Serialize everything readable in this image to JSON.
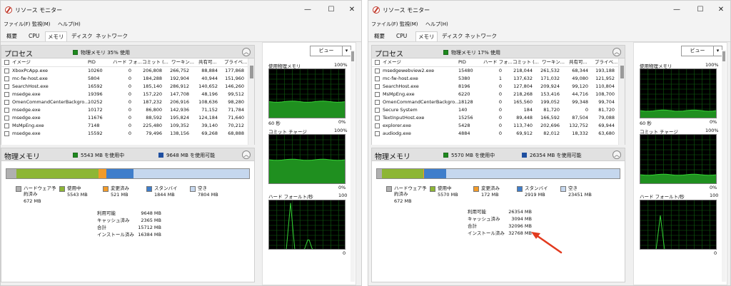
{
  "windows": [
    {
      "title": "リソース モニター",
      "menu": [
        "ファイル(F)",
        "監視(M)",
        "ヘルプ(H)"
      ],
      "tabs": [
        "概要",
        "CPU",
        "メモリ",
        "ディスク",
        "ネットワーク"
      ],
      "active_tab": "メモリ",
      "process": {
        "section_title": "プロセス",
        "header_status": "物理メモリ 35% 使用",
        "columns": [
          "イメージ",
          "PID",
          "ハード フォ...",
          "コミット (...",
          "ワーキン...",
          "共有可...",
          "プライベ..."
        ],
        "rows": [
          [
            "XboxPcApp.exe",
            "10260",
            "0",
            "206,808",
            "266,752",
            "88,884",
            "177,868"
          ],
          [
            "mc-fw-host.exe",
            "5804",
            "0",
            "184,288",
            "192,904",
            "40,944",
            "151,960"
          ],
          [
            "SearchHost.exe",
            "16592",
            "0",
            "185,140",
            "286,912",
            "140,652",
            "146,260"
          ],
          [
            "msedge.exe",
            "19396",
            "0",
            "157,220",
            "147,708",
            "48,196",
            "99,512"
          ],
          [
            "OmenCommandCenterBackgro...",
            "10252",
            "0",
            "187,232",
            "206,916",
            "108,636",
            "98,280"
          ],
          [
            "msedge.exe",
            "10172",
            "0",
            "86,800",
            "142,936",
            "71,152",
            "71,784"
          ],
          [
            "msedge.exe",
            "11676",
            "0",
            "88,592",
            "195,824",
            "124,184",
            "71,640"
          ],
          [
            "MsMpEng.exe",
            "7148",
            "0",
            "225,480",
            "109,352",
            "39,140",
            "70,212"
          ],
          [
            "msedge.exe",
            "15592",
            "0",
            "79,496",
            "138,156",
            "69,268",
            "68,888"
          ]
        ]
      },
      "physical": {
        "section_title": "物理メモリ",
        "in_use_text": "5543 MB を使用中",
        "available_text": "9648 MB を使用可能",
        "bar_fractions": {
          "hw_reserved": 0.041,
          "in_use": 0.338,
          "modified": 0.032,
          "standby": 0.112,
          "free": 0.477
        },
        "legend": [
          {
            "label": "ハードウェア予約済み",
            "value": "672 MB",
            "color": "#b0b0b0"
          },
          {
            "label": "使用中",
            "value": "5543 MB",
            "color": "#8db635"
          },
          {
            "label": "変更済み",
            "value": "521 MB",
            "color": "#f29b2a"
          },
          {
            "label": "スタンバイ",
            "value": "1844 MB",
            "color": "#3f7ecb"
          },
          {
            "label": "空き",
            "value": "7804 MB",
            "color": "#c5d7ee"
          }
        ],
        "stats": [
          {
            "label": "利用可能",
            "value": "9648 MB"
          },
          {
            "label": "キャッシュ済み",
            "value": "2365 MB"
          },
          {
            "label": "合計",
            "value": "15712 MB"
          },
          {
            "label": "インストール済み",
            "value": "16384 MB"
          }
        ]
      },
      "graphs": {
        "view_label": "ビュー",
        "g1_title": "使用物理メモリ",
        "g1_max": "100%",
        "g1_left": "60 秒",
        "g1_min": "0%",
        "g1_level": 0.35,
        "g2_title": "コミット チャージ",
        "g2_max": "100%",
        "g2_min": "0%",
        "g2_level": 0.5,
        "g3_title": "ハード フォールト/秒",
        "g3_max": "100",
        "g3_min": "0"
      }
    },
    {
      "title": "リソース モニター",
      "menu": [
        "ファイル(F)",
        "監視(M)",
        "ヘルプ(H)"
      ],
      "tabs": [
        "概要",
        "CPU",
        "メモリ",
        "ディスク",
        "ネットワーク"
      ],
      "active_tab": "メモリ",
      "process": {
        "section_title": "プロセス",
        "header_status": "物理メモリ 17% 使用",
        "columns": [
          "イメージ",
          "PID",
          "ハード フォ...",
          "コミット (...",
          "ワーキン...",
          "共有可...",
          "プライベ..."
        ],
        "rows": [
          [
            "msedgewebview2.exe",
            "15480",
            "0",
            "218,044",
            "261,532",
            "68,344",
            "193,188"
          ],
          [
            "mc-fw-host.exe",
            "5380",
            "1",
            "137,632",
            "171,032",
            "49,080",
            "121,952"
          ],
          [
            "SearchHost.exe",
            "8196",
            "0",
            "127,804",
            "209,924",
            "99,120",
            "110,804"
          ],
          [
            "MsMpEng.exe",
            "6220",
            "0",
            "218,268",
            "153,416",
            "44,716",
            "108,700"
          ],
          [
            "OmenCommandCenterBackgro...",
            "18128",
            "0",
            "165,560",
            "199,052",
            "99,348",
            "99,704"
          ],
          [
            "Secure System",
            "140",
            "0",
            "184",
            "81,720",
            "0",
            "81,720"
          ],
          [
            "TextInputHost.exe",
            "15256",
            "0",
            "89,448",
            "166,592",
            "87,504",
            "79,088"
          ],
          [
            "explorer.exe",
            "5428",
            "0",
            "113,740",
            "202,696",
            "132,752",
            "69,944"
          ],
          [
            "audiodg.exe",
            "4884",
            "0",
            "69,912",
            "82,012",
            "18,332",
            "63,680"
          ]
        ]
      },
      "physical": {
        "section_title": "物理メモリ",
        "in_use_text": "5570 MB を使用中",
        "available_text": "26354 MB を使用可能",
        "bar_fractions": {
          "hw_reserved": 0.02,
          "in_use": 0.17,
          "modified": 0.005,
          "standby": 0.089,
          "free": 0.716
        },
        "legend": [
          {
            "label": "ハードウェア予約済み",
            "value": "672 MB",
            "color": "#b0b0b0"
          },
          {
            "label": "使用中",
            "value": "5570 MB",
            "color": "#8db635"
          },
          {
            "label": "変更済み",
            "value": "172 MB",
            "color": "#f29b2a"
          },
          {
            "label": "スタンバイ",
            "value": "2919 MB",
            "color": "#3f7ecb"
          },
          {
            "label": "空き",
            "value": "23451 MB",
            "color": "#c5d7ee"
          }
        ],
        "stats": [
          {
            "label": "利用可能",
            "value": "26354 MB"
          },
          {
            "label": "キャッシュ済み",
            "value": "3094 MB"
          },
          {
            "label": "合計",
            "value": "32096 MB"
          },
          {
            "label": "インストール済み",
            "value": "32768 MB"
          }
        ]
      },
      "graphs": {
        "view_label": "ビュー",
        "g1_title": "使用物理メモリ",
        "g1_max": "100%",
        "g1_left": "60 秒",
        "g1_min": "0%",
        "g1_level": 0.17,
        "g2_title": "コミット チャージ",
        "g2_max": "100%",
        "g2_min": "0%",
        "g2_level": 0.2,
        "g3_title": "ハード フォールト/秒",
        "g3_max": "100",
        "g3_min": "0"
      }
    }
  ],
  "colors": {
    "graph_line": "#35d335",
    "graph_fill": "#1f8f1f",
    "arrow": "#e23a1e"
  }
}
